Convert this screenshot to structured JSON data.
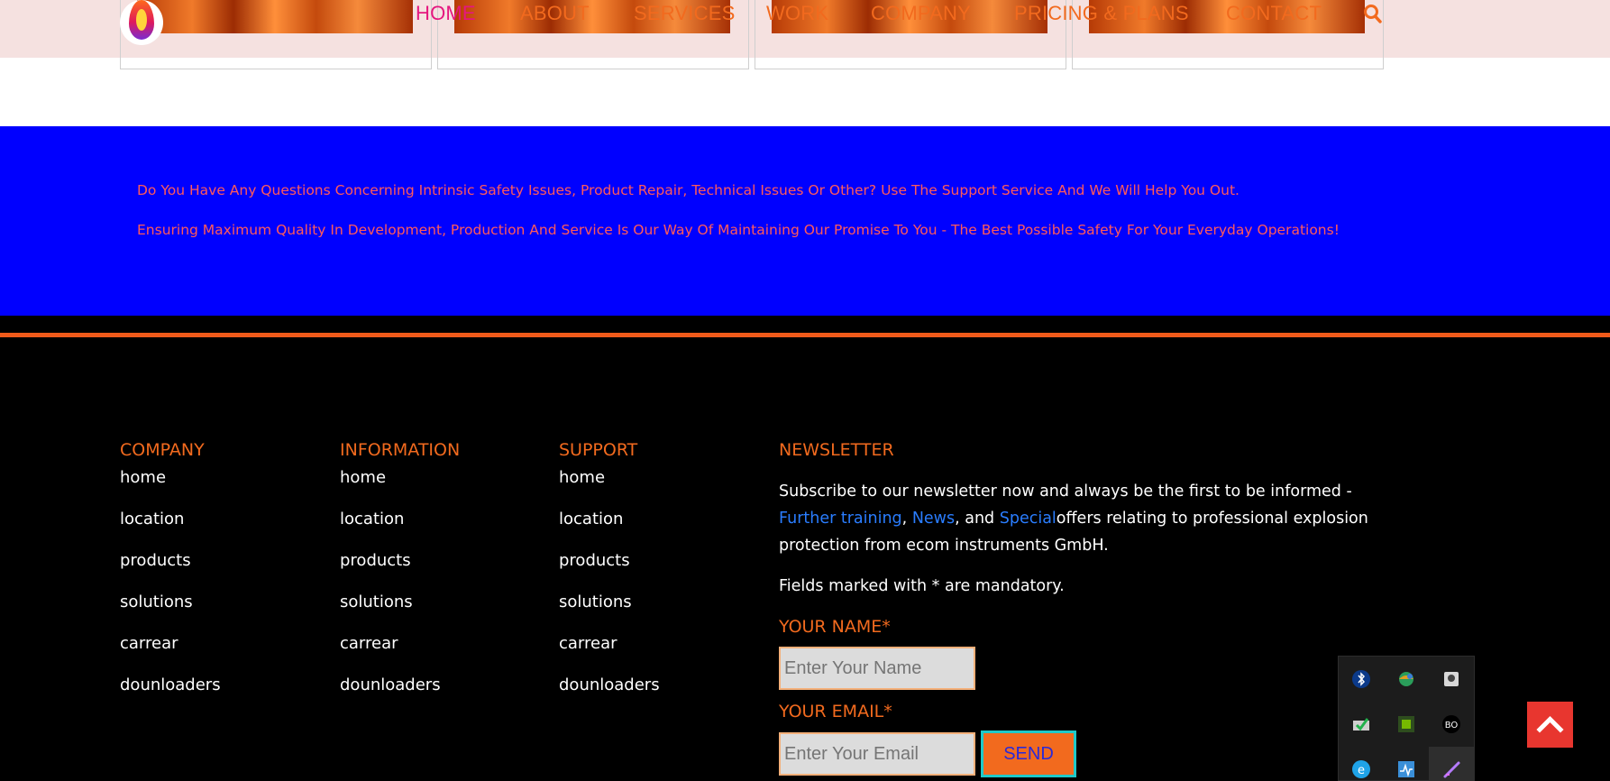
{
  "nav": {
    "items": [
      "HOME",
      "ABOUT",
      "SERVICES",
      "WORK",
      "COMPANY",
      "PRICING & PLANS",
      "CONTACT"
    ],
    "active": "HOME"
  },
  "banner": {
    "line1": "Do You Have Any Questions Concerning Intrinsic Safety Issues, Product Repair, Technical Issues Or Other? Use The Support Service And We Will Help You Out.",
    "line2": "Ensuring Maximum Quality In Development, Production And Service Is Our Way Of Maintaining Our Promise To You - The Best Possible Safety For Your Everyday Operations!"
  },
  "footer": {
    "columns": [
      {
        "title": "COMPANY",
        "links": [
          "home",
          "location",
          "products",
          "solutions",
          "carrear",
          "dounloaders"
        ]
      },
      {
        "title": "INFORMATION",
        "links": [
          "home",
          "location",
          "products",
          "solutions",
          "carrear",
          "dounloaders"
        ]
      },
      {
        "title": "SUPPORT",
        "links": [
          "home",
          "location",
          "products",
          "solutions",
          "carrear",
          "dounloaders"
        ]
      }
    ],
    "newsletter": {
      "title": "NEWSLETTER",
      "desc_start": "Subscribe to our newsletter now and always be the first to be informed - ",
      "link1": "Further training",
      "sep1": ", ",
      "link2": "News",
      "sep2": ", and ",
      "link3": "Special",
      "desc_end": "offers relating to professional explosion protection from ecom instruments GmbH.",
      "mandatory": "Fields marked with * are mandatory.",
      "name_label": "YOUR NAME*",
      "name_placeholder": "Enter Your Name",
      "email_label": "YOUR EMAIL*",
      "email_placeholder": "Enter Your Email",
      "send_label": "SEND"
    }
  },
  "colors": {
    "accent": "#f26a1e",
    "banner": "#0000ff",
    "banner_text": "#ff5a5a",
    "link": "#2a7dff",
    "to_top": "#e8362f"
  },
  "icons": [
    "search-icon",
    "bluetooth-icon",
    "network-globe-icon",
    "disk-icon",
    "checkmark-device-icon",
    "gpu-icon",
    "bang-olufsen-icon",
    "edge-icon",
    "activity-monitor-icon",
    "pen-icon",
    "arrow-up-icon"
  ]
}
